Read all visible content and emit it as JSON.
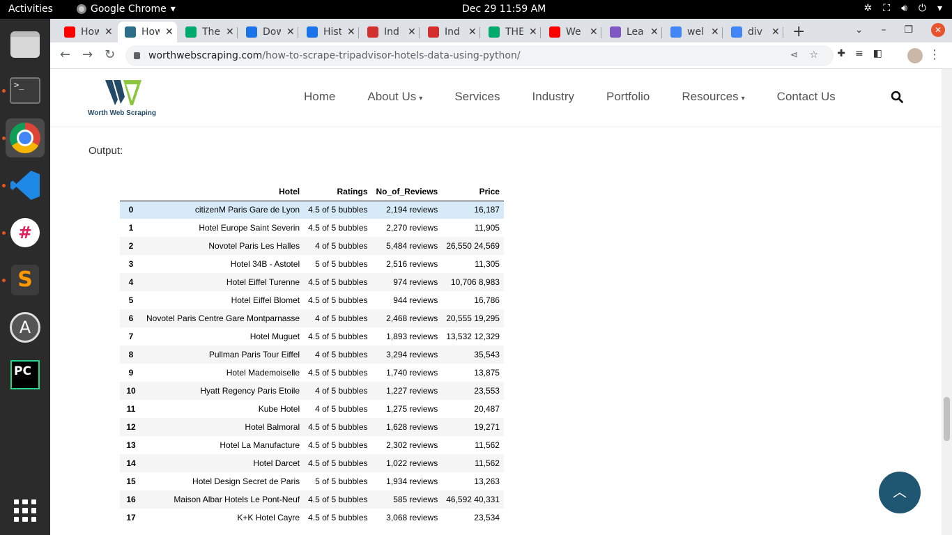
{
  "system": {
    "activities": "Activities",
    "app_name": "Google Chrome",
    "clock": "Dec 29  11:59 AM"
  },
  "tabs": [
    {
      "title": "How",
      "favicon_color": "#ff0000"
    },
    {
      "title": "How",
      "favicon_color": "#2c6e8a"
    },
    {
      "title": "The",
      "favicon_color": "#00aa6c"
    },
    {
      "title": "Dow",
      "favicon_color": "#1a73e8"
    },
    {
      "title": "Hist",
      "favicon_color": "#1a73e8"
    },
    {
      "title": "Ind",
      "favicon_color": "#d32f2f"
    },
    {
      "title": "Ind",
      "favicon_color": "#d32f2f"
    },
    {
      "title": "THE",
      "favicon_color": "#00aa6c"
    },
    {
      "title": "We",
      "favicon_color": "#ff0000"
    },
    {
      "title": "Lea",
      "favicon_color": "#7e57c2"
    },
    {
      "title": "wel",
      "favicon_color": "#4285f4"
    },
    {
      "title": "div",
      "favicon_color": "#4285f4"
    }
  ],
  "address": {
    "domain": "worthwebscraping.com",
    "path": "/how-to-scrape-tripadvisor-hotels-data-using-python/"
  },
  "site": {
    "logo_text": "Worth Web Scraping",
    "menu": [
      "Home",
      "About Us",
      "Services",
      "Industry",
      "Portfolio",
      "Resources",
      "Contact Us"
    ]
  },
  "content": {
    "output_label": "Output:"
  },
  "table": {
    "headers": [
      "",
      "Hotel",
      "Ratings",
      "No_of_Reviews",
      "Price"
    ],
    "rows": [
      [
        "0",
        "citizenM Paris Gare de Lyon",
        "4.5 of 5 bubbles",
        "2,194 reviews",
        "16,187"
      ],
      [
        "1",
        "Hotel Europe Saint Severin",
        "4.5 of 5 bubbles",
        "2,270 reviews",
        "11,905"
      ],
      [
        "2",
        "Novotel Paris Les Halles",
        "4 of 5 bubbles",
        "5,484 reviews",
        "26,550 24,569"
      ],
      [
        "3",
        "Hotel 34B - Astotel",
        "5 of 5 bubbles",
        "2,516 reviews",
        "11,305"
      ],
      [
        "4",
        "Hotel Eiffel Turenne",
        "4.5 of 5 bubbles",
        "974 reviews",
        "10,706 8,983"
      ],
      [
        "5",
        "Hotel Eiffel Blomet",
        "4.5 of 5 bubbles",
        "944 reviews",
        "16,786"
      ],
      [
        "6",
        "Novotel Paris Centre Gare Montparnasse",
        "4 of 5 bubbles",
        "2,468 reviews",
        "20,555 19,295"
      ],
      [
        "7",
        "Hotel Muguet",
        "4.5 of 5 bubbles",
        "1,893 reviews",
        "13,532 12,329"
      ],
      [
        "8",
        "Pullman Paris Tour Eiffel",
        "4 of 5 bubbles",
        "3,294 reviews",
        "35,543"
      ],
      [
        "9",
        "Hotel Mademoiselle",
        "4.5 of 5 bubbles",
        "1,740 reviews",
        "13,875"
      ],
      [
        "10",
        "Hyatt Regency Paris Etoile",
        "4 of 5 bubbles",
        "1,227 reviews",
        "23,553"
      ],
      [
        "11",
        "Kube Hotel",
        "4 of 5 bubbles",
        "1,275 reviews",
        "20,487"
      ],
      [
        "12",
        "Hotel Balmoral",
        "4.5 of 5 bubbles",
        "1,628 reviews",
        "19,271"
      ],
      [
        "13",
        "Hotel La Manufacture",
        "4.5 of 5 bubbles",
        "2,302 reviews",
        "11,562"
      ],
      [
        "14",
        "Hotel Darcet",
        "4.5 of 5 bubbles",
        "1,022 reviews",
        "11,562"
      ],
      [
        "15",
        "Hotel Design Secret de Paris",
        "5 of 5 bubbles",
        "1,934 reviews",
        "13,263"
      ],
      [
        "16",
        "Maison Albar Hotels Le Pont-Neuf",
        "4.5 of 5 bubbles",
        "585 reviews",
        "46,592 40,331"
      ],
      [
        "17",
        "K+K Hotel Cayre",
        "4.5 of 5 bubbles",
        "3,068 reviews",
        "23,534"
      ]
    ]
  }
}
